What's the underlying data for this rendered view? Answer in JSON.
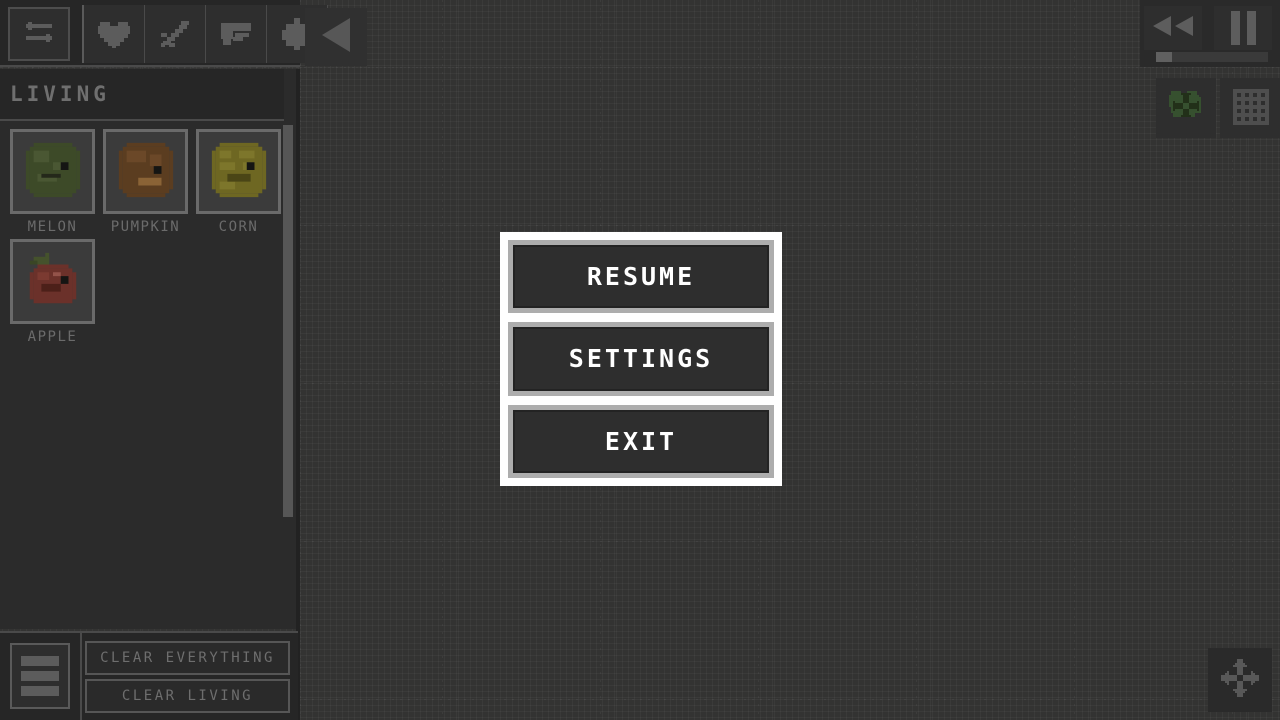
{
  "app": {
    "background_color": "#333332",
    "panel_color": "#2b2b2b",
    "accent_color": "#adadad"
  },
  "toolbar": {
    "tools": [
      {
        "name": "swap-tool",
        "icon": "swap-arrows-icon",
        "label": "Swap"
      },
      {
        "name": "life-tool",
        "icon": "heart-icon",
        "label": "Life"
      },
      {
        "name": "melee-tool",
        "icon": "sword-icon",
        "label": "Melee"
      },
      {
        "name": "ranged-tool",
        "icon": "gun-icon",
        "label": "Ranged"
      },
      {
        "name": "extra-tool",
        "icon": "bomb-icon",
        "label": "Extra"
      }
    ],
    "collapse_button": {
      "icon": "triangle-left-icon",
      "label": "Collapse panel"
    }
  },
  "playback": {
    "rewind_button": {
      "icon": "rewind-icon",
      "label": "Rewind"
    },
    "pause_button": {
      "icon": "pause-icon",
      "label": "Pause"
    },
    "speed_slider": {
      "label": "Speed",
      "value": 6,
      "min": 0,
      "max": 100
    }
  },
  "view_toggles": [
    {
      "name": "creature-move-toggle",
      "icon": "creature-move-icon",
      "label": "Creature move",
      "color": "#3b5538",
      "active": true
    },
    {
      "name": "grid-toggle",
      "icon": "grid-icon",
      "label": "Grid",
      "color": "#4a4a4a",
      "active": false
    }
  ],
  "pan_control": {
    "icon": "move-cross-icon",
    "label": "Pan camera"
  },
  "sidebar": {
    "title": "LIVING",
    "items": [
      {
        "label": "MELON",
        "sprite": "melon-sprite",
        "color": "#44502c",
        "dark": "#323c1f"
      },
      {
        "label": "PUMPKIN",
        "sprite": "pumpkin-sprite",
        "color": "#6b4a26",
        "dark": "#553a1c"
      },
      {
        "label": "CORN",
        "sprite": "corn-sprite",
        "color": "#7c7326",
        "dark": "#62591c"
      },
      {
        "label": "APPLE",
        "sprite": "apple-sprite",
        "color": "#7a322c",
        "dark": "#5e241f"
      }
    ],
    "scrollbar": {
      "position": 0.1,
      "size": 0.7
    }
  },
  "bottom_controls": {
    "menu_button": {
      "icon": "list-menu-icon",
      "label": "Menu"
    },
    "buttons": [
      {
        "label": "CLEAR EVERYTHING",
        "name": "clear-everything-button"
      },
      {
        "label": "CLEAR LIVING",
        "name": "clear-living-button"
      }
    ]
  },
  "pause_menu": {
    "items": [
      {
        "label": "RESUME",
        "name": "resume-button"
      },
      {
        "label": "SETTINGS",
        "name": "settings-button"
      },
      {
        "label": "EXIT",
        "name": "exit-button"
      }
    ]
  }
}
